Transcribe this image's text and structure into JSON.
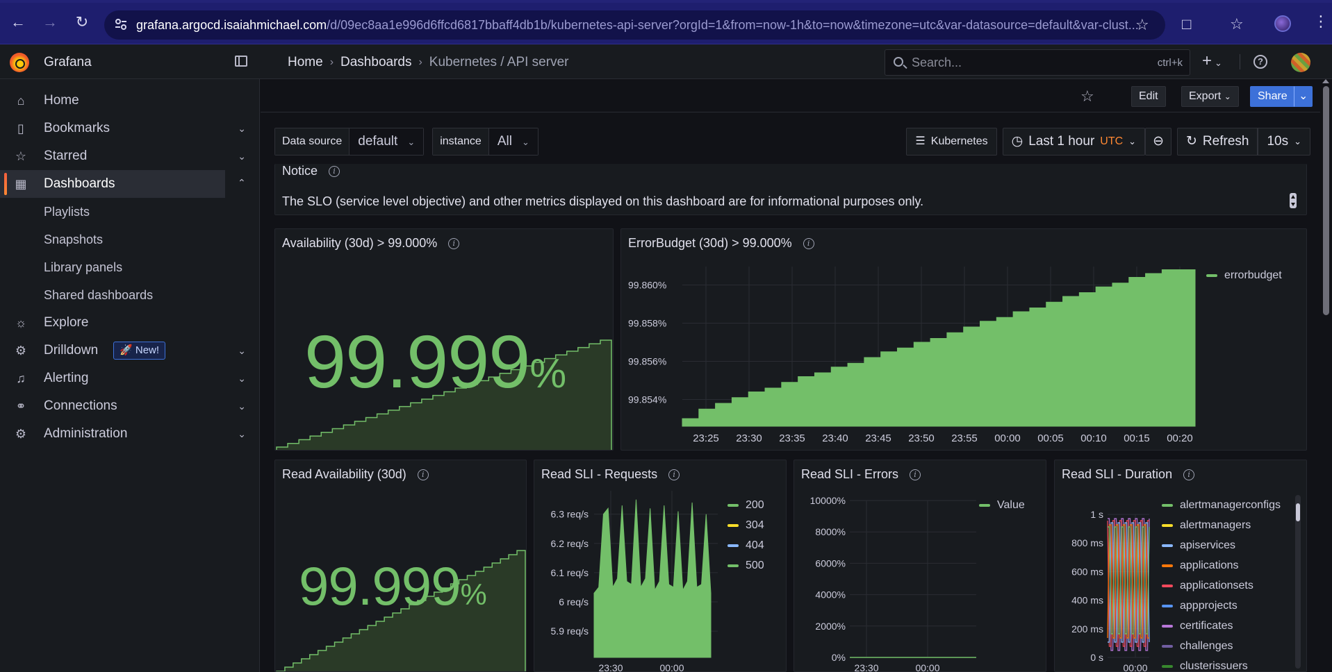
{
  "browser": {
    "url_host": "grafana.argocd.isaiahmichael.com",
    "url_path": "/d/09ec8aa1e996d6ffcd6817bbaff4db1b/kubernetes-api-server?orgId=1&from=now-1h&to=now&timezone=utc&var-datasource=default&var-clust..."
  },
  "topbar": {
    "brand": "Grafana",
    "breadcrumbs": [
      "Home",
      "Dashboards",
      "Kubernetes / API server"
    ],
    "search_placeholder": "Search...",
    "search_shortcut": "ctrl+k"
  },
  "sidebar": {
    "items": [
      {
        "label": "Home",
        "icon": "home-icon"
      },
      {
        "label": "Bookmarks",
        "icon": "bookmark-icon"
      },
      {
        "label": "Starred",
        "icon": "star-icon"
      },
      {
        "label": "Dashboards",
        "icon": "dashboards-icon"
      },
      {
        "label": "Playlists"
      },
      {
        "label": "Snapshots"
      },
      {
        "label": "Library panels"
      },
      {
        "label": "Shared dashboards"
      },
      {
        "label": "Explore",
        "icon": "compass-icon"
      },
      {
        "label": "Drilldown",
        "icon": "drilldown-icon",
        "badge": "New!"
      },
      {
        "label": "Alerting",
        "icon": "bell-icon"
      },
      {
        "label": "Connections",
        "icon": "connections-icon"
      },
      {
        "label": "Administration",
        "icon": "gear-icon"
      }
    ]
  },
  "dashboard": {
    "edit_label": "Edit",
    "export_label": "Export",
    "share_label": "Share",
    "variables": [
      {
        "label": "Data source",
        "value": "default"
      },
      {
        "label": "instance",
        "value": "All"
      }
    ],
    "links_label": "Kubernetes",
    "time_range": "Last 1 hour",
    "timezone": "UTC",
    "refresh_label": "Refresh",
    "refresh_interval": "10s"
  },
  "panels": {
    "notice": {
      "title": "Notice",
      "text": "The SLO (service level objective) and other metrics displayed on this dashboard are for informational purposes only."
    },
    "availability": {
      "title": "Availability (30d) > 99.000%",
      "value": "99.999",
      "unit": "%"
    },
    "errorbudget": {
      "title": "ErrorBudget (30d) > 99.000%",
      "legend": "errorbudget"
    },
    "read_availability": {
      "title": "Read Availability (30d)",
      "value": "99.999",
      "unit": "%"
    },
    "read_requests": {
      "title": "Read SLI - Requests"
    },
    "read_errors": {
      "title": "Read SLI - Errors"
    },
    "read_duration": {
      "title": "Read SLI - Duration"
    }
  },
  "chart_data": [
    {
      "type": "area",
      "panel": "ErrorBudget (30d) > 99.000%",
      "x": [
        "23:21",
        "23:23",
        "23:25",
        "23:27",
        "23:29",
        "23:31",
        "23:33",
        "23:35",
        "23:37",
        "23:39",
        "23:41",
        "23:43",
        "23:45",
        "23:47",
        "23:49",
        "23:51",
        "23:53",
        "23:55",
        "23:57",
        "23:59",
        "00:01",
        "00:03",
        "00:05",
        "00:07",
        "00:09",
        "00:11",
        "00:13",
        "00:15",
        "00:17",
        "00:19",
        "00:21"
      ],
      "xticks": [
        "23:25",
        "23:30",
        "23:35",
        "23:40",
        "23:45",
        "23:50",
        "23:55",
        "00:00",
        "00:05",
        "00:10",
        "00:15",
        "00:20"
      ],
      "yticks": [
        "99.854%",
        "99.856%",
        "99.858%",
        "99.860%"
      ],
      "ylim": [
        99.8526,
        99.8606
      ],
      "series": [
        {
          "name": "errorbudget",
          "color": "#73bf69",
          "values": [
            99.853,
            99.8535,
            99.8538,
            99.8541,
            99.8544,
            99.8546,
            99.8549,
            99.8552,
            99.8554,
            99.8557,
            99.8559,
            99.8562,
            99.8565,
            99.8567,
            99.857,
            99.8572,
            99.8575,
            99.8578,
            99.8581,
            99.8583,
            99.8586,
            99.8588,
            99.8591,
            99.8594,
            99.8596,
            99.8599,
            99.8601,
            99.8604,
            99.8606,
            99.8608,
            99.8608
          ]
        }
      ]
    },
    {
      "type": "area",
      "panel": "Read SLI - Requests",
      "yticks": [
        "5.9 req/s",
        "6 req/s",
        "6.1 req/s",
        "6.2 req/s",
        "6.3 req/s"
      ],
      "xticks": [
        "23:30",
        "00:00"
      ],
      "ylim": [
        5.81,
        6.38
      ],
      "series": [
        {
          "name": "200",
          "color": "#73bf69",
          "values": [
            6.03,
            6.05,
            6.3,
            6.32,
            6.05,
            6.08,
            6.33,
            6.07,
            6.06,
            6.35,
            6.05,
            6.08,
            6.32,
            6.04,
            6.07,
            6.33,
            6.06,
            6.05,
            6.31,
            6.04,
            6.07,
            6.34,
            6.05,
            6.06,
            6.3,
            6.03
          ]
        },
        {
          "name": "304",
          "color": "#fade2a",
          "values": []
        },
        {
          "name": "404",
          "color": "#8ab8ff",
          "values": []
        },
        {
          "name": "500",
          "color": "#73bf69",
          "values": []
        }
      ]
    },
    {
      "type": "line",
      "panel": "Read SLI - Errors",
      "yticks": [
        "0%",
        "2000%",
        "4000%",
        "6000%",
        "8000%",
        "10000%"
      ],
      "xticks": [
        "23:30",
        "00:00"
      ],
      "ylim": [
        0,
        10000
      ],
      "series": [
        {
          "name": "Value",
          "color": "#73bf69",
          "values": [
            0,
            0,
            0,
            0,
            0,
            0,
            0,
            0,
            0,
            0,
            0,
            0
          ]
        }
      ]
    },
    {
      "type": "line",
      "panel": "Read SLI - Duration",
      "yticks": [
        "0 s",
        "200 ms",
        "400 ms",
        "600 ms",
        "800 ms",
        "1 s"
      ],
      "xticks": [
        "00:00"
      ],
      "ylim": [
        0,
        1
      ],
      "series": [
        {
          "name": "alertmanagerconfigs",
          "color": "#73bf69"
        },
        {
          "name": "alertmanagers",
          "color": "#fade2a"
        },
        {
          "name": "apiservices",
          "color": "#8ab8ff"
        },
        {
          "name": "applications",
          "color": "#ff780a"
        },
        {
          "name": "applicationsets",
          "color": "#f2495c"
        },
        {
          "name": "appprojects",
          "color": "#5794f2"
        },
        {
          "name": "certificates",
          "color": "#b877d9"
        },
        {
          "name": "challenges",
          "color": "#705da0"
        },
        {
          "name": "clusterissuers",
          "color": "#37872d"
        }
      ]
    }
  ]
}
